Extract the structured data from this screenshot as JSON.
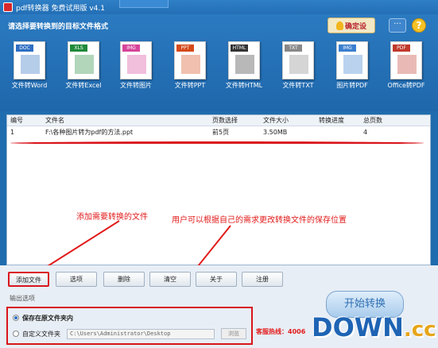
{
  "window": {
    "title": "pdf转换器 免费试用版 v4.1"
  },
  "header": {
    "prompt": "请选择要转换到的目标文件格式",
    "badge": "确定设",
    "chat_icon": "···",
    "help_icon": "?"
  },
  "tools": [
    {
      "tag": "DOC",
      "tag_color": "#2e6fc3",
      "label": "文件转Word"
    },
    {
      "tag": "XLS",
      "tag_color": "#1f8a3a",
      "label": "文件转Excel"
    },
    {
      "tag": "IMG",
      "tag_color": "#d6449a",
      "label": "文件转图片"
    },
    {
      "tag": "PPT",
      "tag_color": "#d64a1a",
      "label": "文件转PPT"
    },
    {
      "tag": "HTML",
      "tag_color": "#333333",
      "label": "文件转HTML"
    },
    {
      "tag": "TXT",
      "tag_color": "#888888",
      "label": "文件转TXT"
    },
    {
      "tag": "IMG",
      "tag_color": "#3a7fcf",
      "label": "图片转PDF"
    },
    {
      "tag": "PDF",
      "tag_color": "#c0392b",
      "label": "Office转PDF"
    }
  ],
  "table": {
    "headers": [
      "编号",
      "文件名",
      "页数选择",
      "文件大小",
      "转换进度",
      "总页数"
    ],
    "rows": [
      [
        "1",
        "F:\\各种图片转为pdf的方法.ppt",
        "前5页",
        "3.50MB",
        "",
        "4"
      ]
    ]
  },
  "annotations": {
    "add_hint": "添加需要转换的文件",
    "save_hint": "用户可以根据自己的需求更改转换文件的保存位置"
  },
  "buttons": {
    "add_file": "添加文件",
    "options": "选项",
    "delete": "删除",
    "clear": "清空",
    "about": "关于",
    "register": "注册"
  },
  "output": {
    "title": "输出选项",
    "save_original": "保存在原文件夹内",
    "custom_folder": "自定义文件夹",
    "path": "C:\\Users\\Administrator\\Desktop",
    "browse": "浏览",
    "start": "开始转换",
    "hotline": "客服热线：4006"
  },
  "watermark": {
    "main": "DOWN",
    "suffix": ".cc"
  }
}
